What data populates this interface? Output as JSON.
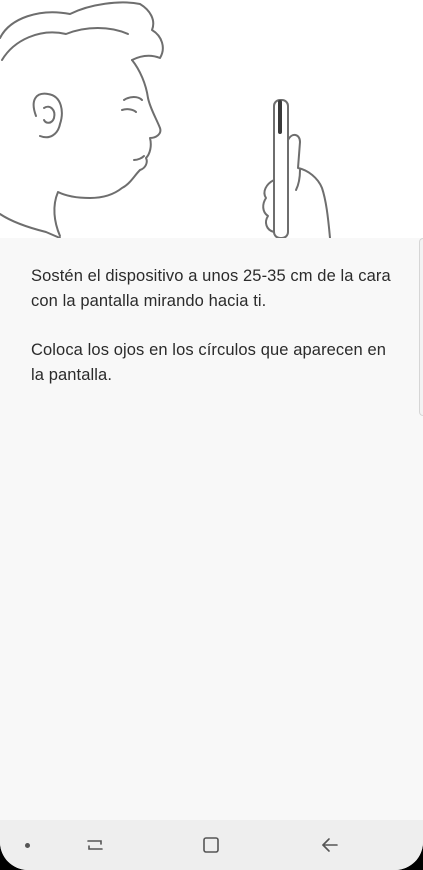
{
  "instructions": {
    "paragraph_1": "Sostén el dispositivo a unos 25-35 cm de la cara con la pantalla mirando hacia ti.",
    "paragraph_2": "Coloca los ojos en los círculos que aparecen en la pantalla."
  },
  "illustration": {
    "icon": "person-holding-phone-illustration"
  },
  "navbar": {
    "items": [
      {
        "icon": "dot-indicator-icon"
      },
      {
        "icon": "recent-apps-icon"
      },
      {
        "icon": "home-icon"
      },
      {
        "icon": "back-icon"
      }
    ]
  }
}
